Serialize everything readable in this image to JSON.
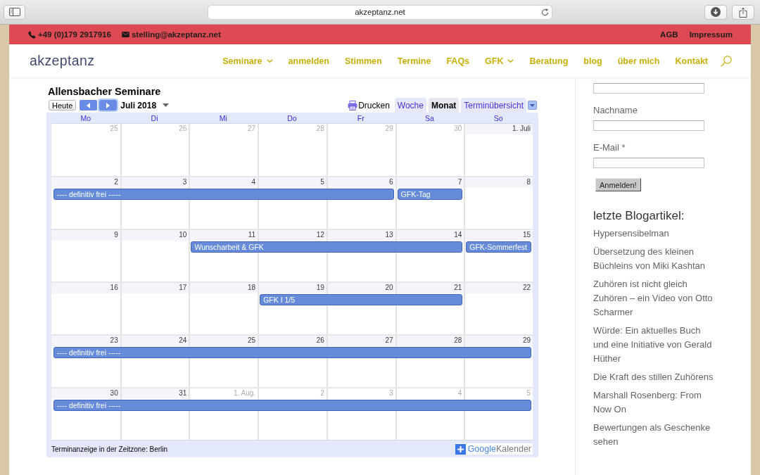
{
  "browser": {
    "address": "akzeptanz.net"
  },
  "top_bar": {
    "phone": "+49 (0)179 2917916",
    "email": "stelling@akzeptanz.net",
    "links": [
      "AGB",
      "Impressum"
    ]
  },
  "nav": {
    "logo": "akzeptanz",
    "items": [
      {
        "label": "Seminare",
        "has_submenu": true
      },
      {
        "label": "anmelden",
        "has_submenu": false
      },
      {
        "label": "Stimmen",
        "has_submenu": false
      },
      {
        "label": "Termine",
        "has_submenu": false
      },
      {
        "label": "FAQs",
        "has_submenu": false
      },
      {
        "label": "GFK",
        "has_submenu": true
      },
      {
        "label": "Beratung",
        "has_submenu": false
      },
      {
        "label": "blog",
        "has_submenu": false
      },
      {
        "label": "über mich",
        "has_submenu": false
      },
      {
        "label": "Kontakt",
        "has_submenu": false
      }
    ]
  },
  "calendar": {
    "title": "Allensbacher Seminare",
    "today_button": "Heute",
    "nav_buttons": [
      {
        "kind": "prev",
        "focused": false
      },
      {
        "kind": "next",
        "focused": true
      }
    ],
    "period": "Juli 2018",
    "print": "Drucken",
    "views": [
      {
        "label": "Woche",
        "selected": false
      },
      {
        "label": "Monat",
        "selected": true
      },
      {
        "label": "Terminübersicht",
        "selected": false
      }
    ],
    "weekdays": [
      "Mo",
      "Di",
      "Mi",
      "Do",
      "Fr",
      "Sa",
      "So"
    ],
    "weeks": [
      {
        "days": [
          {
            "label": "25",
            "in_month": false
          },
          {
            "label": "26",
            "in_month": false
          },
          {
            "label": "27",
            "in_month": false
          },
          {
            "label": "28",
            "in_month": false
          },
          {
            "label": "29",
            "in_month": false
          },
          {
            "label": "30",
            "in_month": false
          },
          {
            "label": "1. Juli",
            "in_month": true
          }
        ]
      },
      {
        "days": [
          {
            "label": "2",
            "in_month": true
          },
          {
            "label": "3",
            "in_month": true
          },
          {
            "label": "4",
            "in_month": true
          },
          {
            "label": "5",
            "in_month": true
          },
          {
            "label": "6",
            "in_month": true
          },
          {
            "label": "7",
            "in_month": true
          },
          {
            "label": "8",
            "in_month": true
          }
        ],
        "bars": [
          {
            "kind": "event",
            "title": "---- definitiv frei -----"
          },
          {
            "kind": "continued"
          },
          {
            "kind": "continued"
          },
          {
            "kind": "continued"
          },
          {
            "kind": "continued"
          },
          {
            "kind": "event",
            "title": "GFK-Tag"
          },
          {
            "kind": "empty"
          }
        ]
      },
      {
        "days": [
          {
            "label": "9",
            "in_month": true
          },
          {
            "label": "10",
            "in_month": true
          },
          {
            "label": "11",
            "in_month": true
          },
          {
            "label": "12",
            "in_month": true
          },
          {
            "label": "13",
            "in_month": true
          },
          {
            "label": "14",
            "in_month": true
          },
          {
            "label": "15",
            "in_month": true
          }
        ],
        "bars": [
          {
            "kind": "empty"
          },
          {
            "kind": "empty"
          },
          {
            "kind": "event",
            "title": "Wunscharbeit & GFK"
          },
          {
            "kind": "continued"
          },
          {
            "kind": "continued"
          },
          {
            "kind": "continued"
          },
          {
            "kind": "event",
            "title": "GFK-Sommerfest"
          }
        ]
      },
      {
        "days": [
          {
            "label": "16",
            "in_month": true
          },
          {
            "label": "17",
            "in_month": true
          },
          {
            "label": "18",
            "in_month": true
          },
          {
            "label": "19",
            "in_month": true
          },
          {
            "label": "20",
            "in_month": true
          },
          {
            "label": "21",
            "in_month": true
          },
          {
            "label": "22",
            "in_month": true
          }
        ],
        "bars": [
          {
            "kind": "empty"
          },
          {
            "kind": "empty"
          },
          {
            "kind": "empty"
          },
          {
            "kind": "event",
            "title": "GFK I 1/5"
          },
          {
            "kind": "continued"
          },
          {
            "kind": "continued"
          },
          {
            "kind": "empty"
          }
        ]
      },
      {
        "days": [
          {
            "label": "23",
            "in_month": true
          },
          {
            "label": "24",
            "in_month": true
          },
          {
            "label": "25",
            "in_month": true
          },
          {
            "label": "26",
            "in_month": true
          },
          {
            "label": "27",
            "in_month": true
          },
          {
            "label": "28",
            "in_month": true
          },
          {
            "label": "29",
            "in_month": true
          }
        ],
        "bars": [
          {
            "kind": "event",
            "title": "---- definitiv frei -----"
          },
          {
            "kind": "continued"
          },
          {
            "kind": "continued"
          },
          {
            "kind": "continued"
          },
          {
            "kind": "continued"
          },
          {
            "kind": "continued"
          },
          {
            "kind": "continued"
          }
        ]
      },
      {
        "days": [
          {
            "label": "30",
            "in_month": true
          },
          {
            "label": "31",
            "in_month": true
          },
          {
            "label": "1. Aug.",
            "in_month": false
          },
          {
            "label": "2",
            "in_month": false
          },
          {
            "label": "3",
            "in_month": false
          },
          {
            "label": "4",
            "in_month": false
          },
          {
            "label": "5",
            "in_month": false
          }
        ],
        "bars": [
          {
            "kind": "event",
            "title": "---- definitiv frei -----"
          },
          {
            "kind": "continued"
          },
          {
            "kind": "continued"
          },
          {
            "kind": "continued"
          },
          {
            "kind": "continued"
          },
          {
            "kind": "continued"
          },
          {
            "kind": "continued"
          }
        ]
      }
    ],
    "timezone_note": "Terminanzeige in der Zeitzone: Berlin",
    "badge": {
      "brand": "Google",
      "label": "Kalender"
    }
  },
  "sidebar": {
    "form": [
      {
        "kind": "field"
      },
      {
        "kind": "label",
        "text": "Nachname"
      },
      {
        "kind": "field"
      },
      {
        "kind": "label",
        "text": "E-Mail *"
      },
      {
        "kind": "field"
      },
      {
        "kind": "button",
        "text": "Anmelden!"
      }
    ],
    "heading": "letzte Blogartikel:",
    "posts": [
      "Hypersensibelman",
      "Übersetzung des kleinen Büchleins von Miki Kashtan",
      "Zuhören ist nicht gleich Zuhören – ein Video von Otto Scharmer",
      "Würde: Ein aktuelles Buch und eine Initiative von Gerald Hüther",
      "Die Kraft des stillen Zuhörens",
      "Marshall Rosenberg: From Now On",
      "Bewertungen als Geschenke sehen"
    ]
  }
}
